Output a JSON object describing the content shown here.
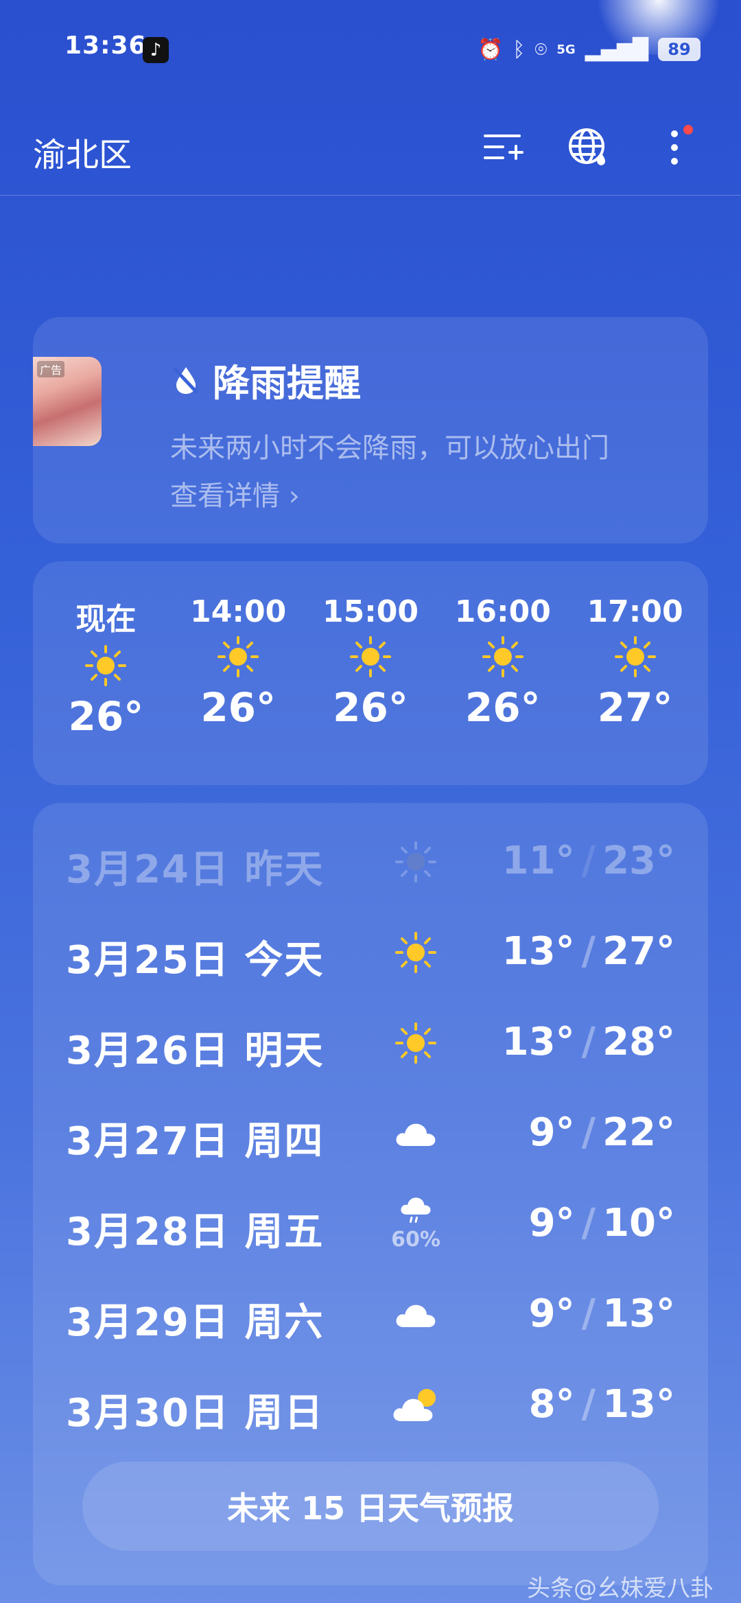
{
  "status_bar": {
    "time": "13:36",
    "network": "5G",
    "battery": "89"
  },
  "header": {
    "city": "渝北区"
  },
  "rain_alert": {
    "title": "降雨提醒",
    "description": "未来两小时不会降雨，可以放心出门",
    "link": "查看详情",
    "ad_tag": "广告"
  },
  "hourly": [
    {
      "label": "现在",
      "icon": "sun-icon",
      "temp": "26°"
    },
    {
      "label": "14:00",
      "icon": "sun-icon",
      "temp": "26°"
    },
    {
      "label": "15:00",
      "icon": "sun-icon",
      "temp": "26°"
    },
    {
      "label": "16:00",
      "icon": "sun-icon",
      "temp": "26°"
    },
    {
      "label": "17:00",
      "icon": "sun-icon",
      "temp": "27°"
    }
  ],
  "daily": [
    {
      "date": "3月24日 昨天",
      "icon": "sun-icon",
      "low": "11°",
      "high": "23°",
      "precip": ""
    },
    {
      "date": "3月25日 今天",
      "icon": "sun-icon",
      "low": "13°",
      "high": "27°",
      "precip": ""
    },
    {
      "date": "3月26日 明天",
      "icon": "sun-icon",
      "low": "13°",
      "high": "28°",
      "precip": ""
    },
    {
      "date": "3月27日 周四",
      "icon": "cloud-icon",
      "low": "9°",
      "high": "22°",
      "precip": ""
    },
    {
      "date": "3月28日 周五",
      "icon": "rain-cloud-icon",
      "low": "9°",
      "high": "10°",
      "precip": "60%"
    },
    {
      "date": "3月29日 周六",
      "icon": "cloud-icon",
      "low": "9°",
      "high": "13°",
      "precip": ""
    },
    {
      "date": "3月30日 周日",
      "icon": "partly-cloudy-icon",
      "low": "8°",
      "high": "13°",
      "precip": ""
    }
  ],
  "forecast_button": "未来 15 日天气预报",
  "watermark": "头条@幺妹爱八卦",
  "colors": {
    "background": "#2a4fcf",
    "sun": "#ffc928",
    "notification_dot": "#ff4b4b"
  }
}
